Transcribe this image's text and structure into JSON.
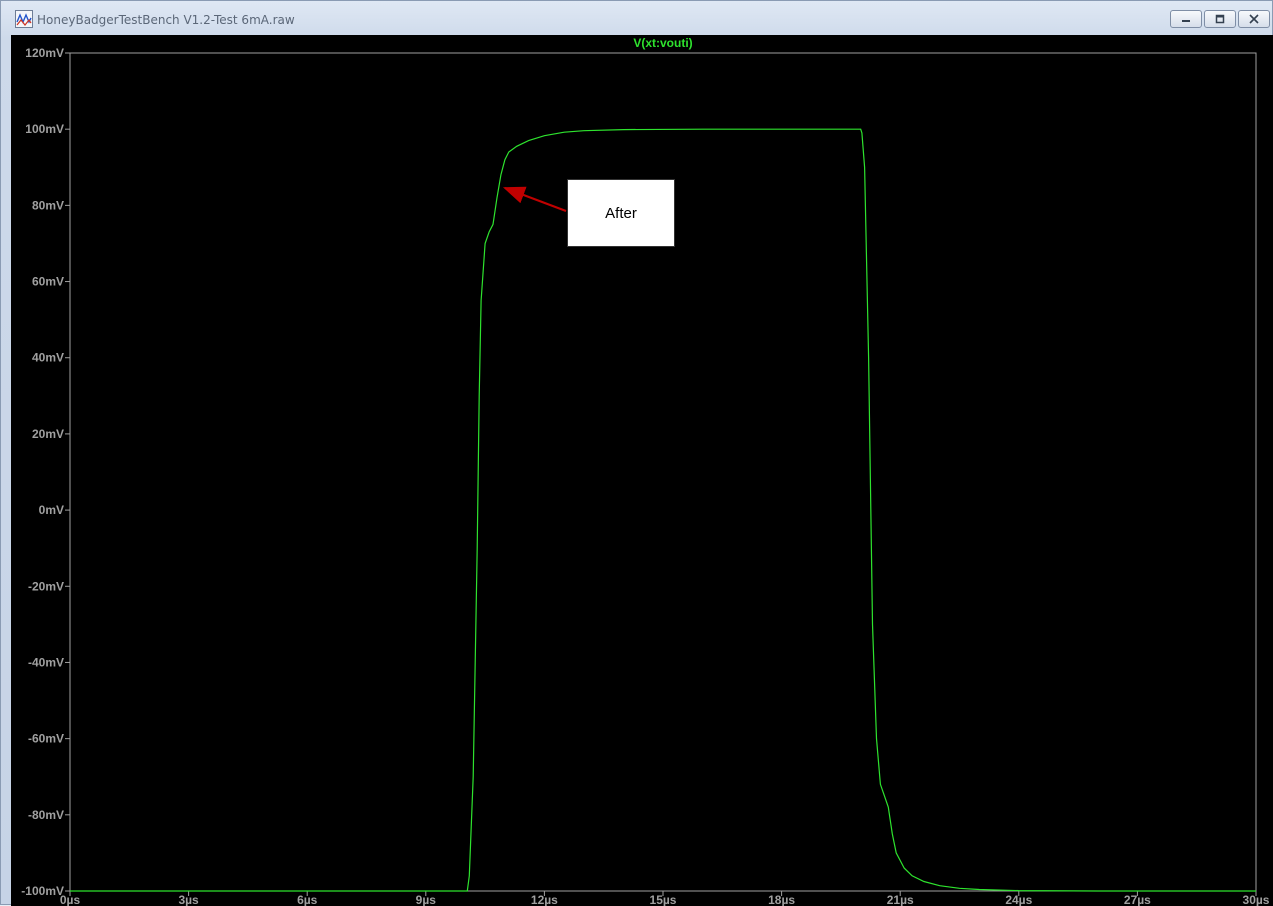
{
  "window": {
    "title": "HoneyBadgerTestBench V1.2-Test 6mA.raw",
    "icons": {
      "app": "waveform-app-icon",
      "minimize": "minimize-icon",
      "maximize": "maximize-icon",
      "close": "close-icon"
    }
  },
  "colors": {
    "background": "#000000",
    "trace": "#2ee32e",
    "axis": "#a0a0a0",
    "arrow": "#c00000"
  },
  "annotation": {
    "label": "After"
  },
  "chart_data": {
    "type": "line",
    "title": "V(xt:vouti)",
    "xlabel": "",
    "ylabel": "",
    "xlim": [
      0,
      30
    ],
    "ylim": [
      -100,
      120
    ],
    "grid": false,
    "y_ticks": [
      120,
      100,
      80,
      60,
      40,
      20,
      0,
      -20,
      -40,
      -60,
      -80,
      -100
    ],
    "y_tick_labels": [
      "120mV",
      "100mV",
      "80mV",
      "60mV",
      "40mV",
      "20mV",
      "0mV",
      "-20mV",
      "-40mV",
      "-60mV",
      "-80mV",
      "-100mV"
    ],
    "x_ticks": [
      0,
      3,
      6,
      9,
      12,
      15,
      18,
      21,
      24,
      27,
      30
    ],
    "x_tick_labels": [
      "0µs",
      "3µs",
      "6µs",
      "9µs",
      "12µs",
      "15µs",
      "18µs",
      "21µs",
      "24µs",
      "27µs",
      "30µs"
    ],
    "series": [
      {
        "name": "V(xt:vouti)",
        "x": [
          0,
          10.05,
          10.1,
          10.2,
          10.3,
          10.35,
          10.4,
          10.5,
          10.6,
          10.7,
          10.8,
          10.9,
          11.0,
          11.1,
          11.3,
          11.6,
          12.0,
          12.5,
          13.0,
          14.0,
          16.0,
          20.0,
          20.03,
          20.1,
          20.2,
          20.3,
          20.4,
          20.5,
          20.6,
          20.7,
          20.8,
          20.9,
          21.0,
          21.1,
          21.3,
          21.6,
          22.0,
          22.5,
          23.0,
          24.0,
          26.0,
          30.0
        ],
        "y": [
          -100,
          -100,
          -96,
          -70,
          -10,
          30,
          55,
          70,
          73,
          75,
          82,
          88,
          92,
          94,
          95.5,
          97,
          98.3,
          99.2,
          99.6,
          99.9,
          100,
          100,
          99,
          90,
          40,
          -30,
          -60,
          -72,
          -75,
          -78,
          -85,
          -90,
          -92,
          -94,
          -96,
          -97.5,
          -98.6,
          -99.3,
          -99.6,
          -99.9,
          -100,
          -100
        ]
      }
    ]
  }
}
